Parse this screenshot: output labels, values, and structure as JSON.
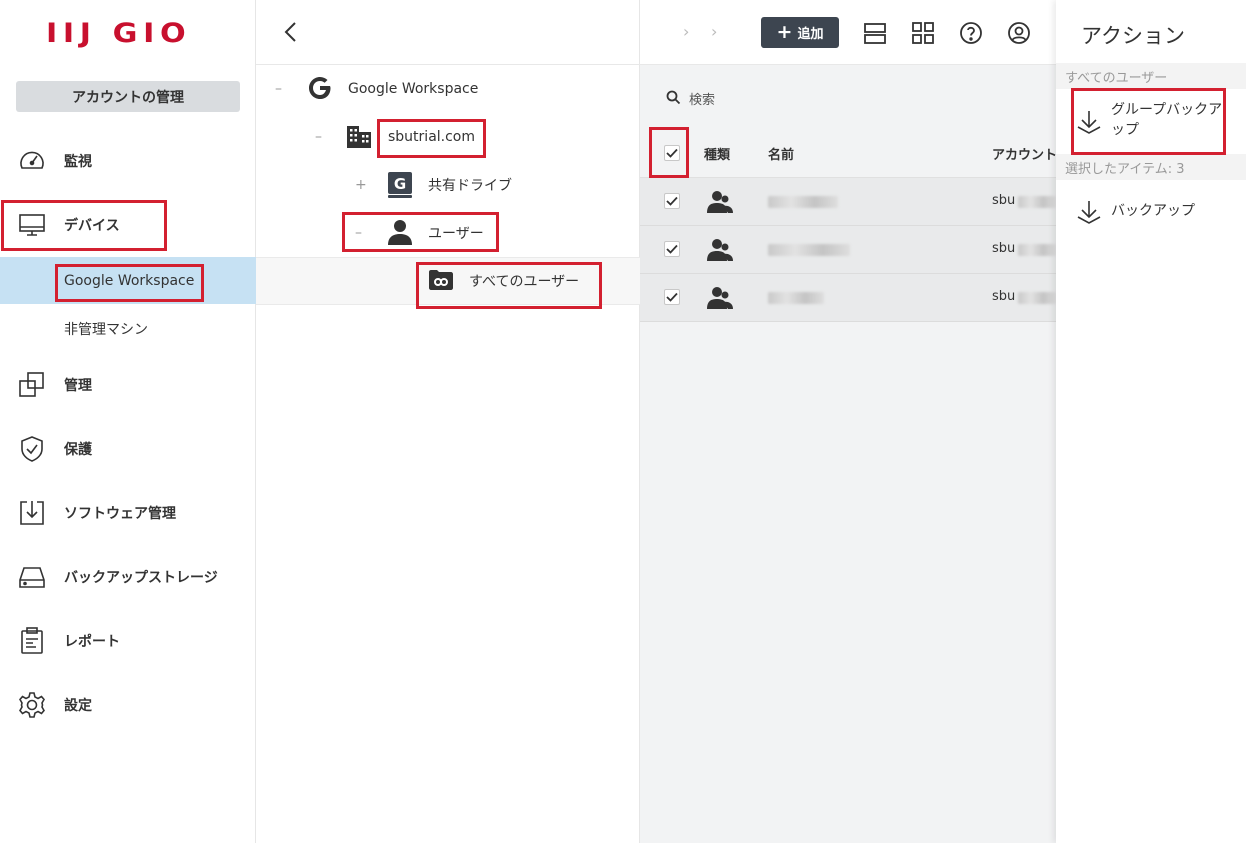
{
  "logo": "IIJ GIO",
  "sidebar": {
    "account_button": "アカウントの管理",
    "items": [
      {
        "label": "監視",
        "icon": "gauge-icon"
      },
      {
        "label": "デバイス",
        "icon": "monitor-icon"
      },
      {
        "label": "管理",
        "icon": "copy-icon"
      },
      {
        "label": "保護",
        "icon": "shield-icon"
      },
      {
        "label": "ソフトウェア管理",
        "icon": "software-download-icon"
      },
      {
        "label": "バックアップストレージ",
        "icon": "drive-icon"
      },
      {
        "label": "レポート",
        "icon": "clipboard-icon"
      },
      {
        "label": "設定",
        "icon": "gear-icon"
      }
    ],
    "subitems": [
      {
        "label": "Google Workspace",
        "active": true
      },
      {
        "label": "非管理マシン",
        "active": false
      }
    ]
  },
  "tree": {
    "nodes": [
      {
        "label": "Google Workspace",
        "toggle": "–",
        "icon": "google-icon"
      },
      {
        "label": "sbutrial.com",
        "toggle": "–",
        "icon": "building-icon"
      },
      {
        "label": "共有ドライブ",
        "toggle": "+",
        "icon": "google-drive-icon"
      },
      {
        "label": "ユーザー",
        "toggle": "–",
        "icon": "user-icon"
      },
      {
        "label": "すべてのユーザー",
        "toggle": "",
        "icon": "group-folder-icon"
      }
    ]
  },
  "toolbar": {
    "breadcrumb_sep": "›",
    "add_label": "追加"
  },
  "search": {
    "label": "検索"
  },
  "table": {
    "headers": {
      "type": "種類",
      "name": "名前",
      "account": "アカウント"
    },
    "rows": [
      {
        "account": "sbu",
        "checked": true
      },
      {
        "account": "sbu",
        "checked": true
      },
      {
        "account": "sbu",
        "checked": true
      }
    ]
  },
  "actions": {
    "title": "アクション",
    "section_all": "すべてのユーザー",
    "group_backup": "グループバックアップ",
    "section_selected": "選択したアイテム: 3",
    "backup": "バックアップ"
  },
  "colors": {
    "highlight": "#d32030",
    "brand": "#c8102e",
    "active_bg": "#c6e1f3"
  }
}
